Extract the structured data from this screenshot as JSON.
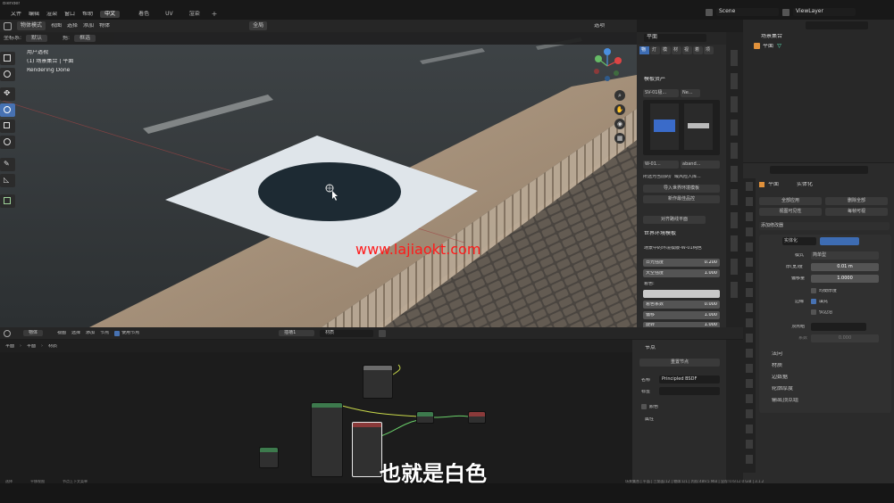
{
  "window": {
    "title": "Blender"
  },
  "menus": [
    "文件",
    "编辑",
    "渲染",
    "窗口",
    "帮助"
  ],
  "workspace_tabs": [
    {
      "label": "中文",
      "active": true
    },
    {
      "label": "着色",
      "active": false
    },
    {
      "label": "UV",
      "active": false
    },
    {
      "label": "渲染",
      "active": false
    }
  ],
  "scene": {
    "name": "Scene",
    "view_layer": "ViewLayer"
  },
  "viewport": {
    "mode": "物体模式",
    "menu": [
      "视图",
      "选择",
      "添加",
      "物体"
    ],
    "coord_label": "坐标系:",
    "coord_value": "默认",
    "drag_label": "拖:",
    "drag_value": "框选",
    "shading_label": "全局",
    "view_name": "用户透视",
    "collection_info": "(1) 场景集合 | 平面",
    "render_status": "Rendering Done",
    "overlay_label": "选项"
  },
  "npanel": {
    "search": "平面",
    "tabs": [
      "物",
      "灯",
      "模",
      "材",
      "视",
      "着",
      "项"
    ],
    "assets_title": "模板资产",
    "asset_left": "SV-01极...",
    "asset_right": "Ne...",
    "asset_name_left": "W-01...",
    "asset_name_right": "aband...",
    "warning": "所选为当前的广域风险入库...",
    "import_button": "导入世界环境模板",
    "recently_button": "新作最佳品控",
    "align_button": "对齐路线平面",
    "world_title": "世界环境模板",
    "world_desc": "场景中的环境模版-W-01纯色",
    "fields": [
      {
        "label": "日光强度",
        "value": "0.200"
      },
      {
        "label": "天空强度",
        "value": "1.000"
      }
    ],
    "color_label": "着色:",
    "fields2": [
      {
        "label": "着色系数",
        "value": "0.000"
      },
      {
        "label": "偏移",
        "value": "1.000"
      },
      {
        "label": "旋转",
        "value": "1.000"
      }
    ]
  },
  "outliner": {
    "search_placeholder": "",
    "collection": "场景集合",
    "object": "平面"
  },
  "properties": {
    "search_placeholder": "",
    "breadcrumb_object": "平面",
    "breadcrumb_modifier": "实体化",
    "apply_all": "全部应用",
    "remove_all": "删除全部",
    "toggle_view": "视图可见性",
    "toggle_render": "每帧可视",
    "add_modifier": "添加修改器",
    "modifier_name": "实体化",
    "mode_label": "模式",
    "mode_value": "简单型",
    "thickness_label": "厚(宽)度",
    "thickness_value": "0.01 m",
    "offset_label": "偏移量",
    "offset_value": "1.0000",
    "even_thickness": "均衡厚度",
    "rim_label": "边缘",
    "rim_fill": "填充",
    "rim_only": "仅边沿",
    "vertex_group_label": "顶点组",
    "factor_label": "系数",
    "factor_value": "0.000",
    "sections": [
      "法向",
      "材质",
      "边数据",
      "轮廓厚度",
      "输出顶点组"
    ]
  },
  "node_editor": {
    "mode": "物体",
    "menu": [
      "视图",
      "选择",
      "添加",
      "节点"
    ],
    "use_nodes": "使用节点",
    "slot": "插槽1",
    "material": "材质",
    "breadcrumb": [
      "平面",
      "平面",
      "材质"
    ]
  },
  "node_side": {
    "title": "节点",
    "reset": "重置节点",
    "name_label": "名称",
    "name_value": "Principled BSDF",
    "label_label": "标签",
    "color_label": "颜色",
    "props_label": "属性"
  },
  "watermark": "www.lajiaokt.com",
  "subtitle": "也就是白色",
  "status_left": [
    "选择",
    "平移视图",
    "节点上下文菜单"
  ],
  "status_right": "场景集合 | 平面 | 三角面:12 | 物体:1/1 | 内存:489.5 MiB | 显存:0.6/12.0 GiB | 3.1.2",
  "colors": {
    "accent": "#4772b3",
    "viewport_bg": "#3b3f42",
    "panel": "#2b2b2b"
  }
}
